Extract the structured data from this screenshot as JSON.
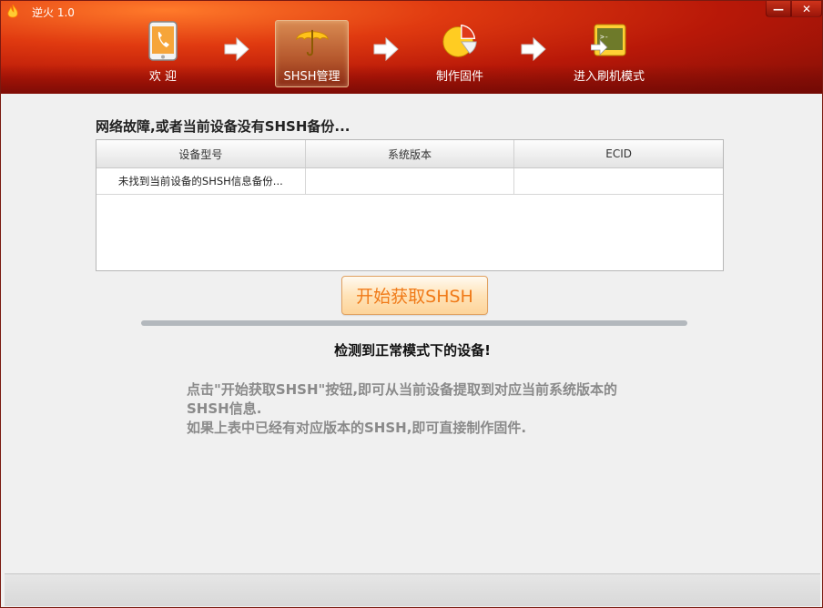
{
  "window": {
    "title": "逆火 1.0",
    "min_label": "—",
    "close_label": "✕"
  },
  "nav": {
    "steps": [
      {
        "label": "欢 迎",
        "icon": "phone-icon"
      },
      {
        "label": "SHSH管理",
        "icon": "umbrella-icon",
        "active": true
      },
      {
        "label": "制作固件",
        "icon": "pie-chart-icon"
      },
      {
        "label": "进入刷机模式",
        "icon": "terminal-icon"
      }
    ]
  },
  "main": {
    "section_title": "网络故障,或者当前设备没有SHSH备份...",
    "table": {
      "columns": [
        "设备型号",
        "系统版本",
        "ECID"
      ],
      "rows": [
        [
          "未找到当前设备的SHSH信息备份...",
          "",
          ""
        ]
      ]
    },
    "get_button_label": "开始获取SHSH",
    "progress": 0,
    "status_text": "检测到正常模式下的设备!",
    "hint_lines": [
      "点击\"开始获取SHSH\"按钮,即可从当前设备提取到对应当前系统版本的",
      "SHSH信息.",
      "如果上表中已经有对应版本的SHSH,即可直接制作固件."
    ]
  },
  "colors": {
    "header_red": "#b81808",
    "button_text": "#f07a18",
    "hint_gray": "#8a8a8a"
  }
}
